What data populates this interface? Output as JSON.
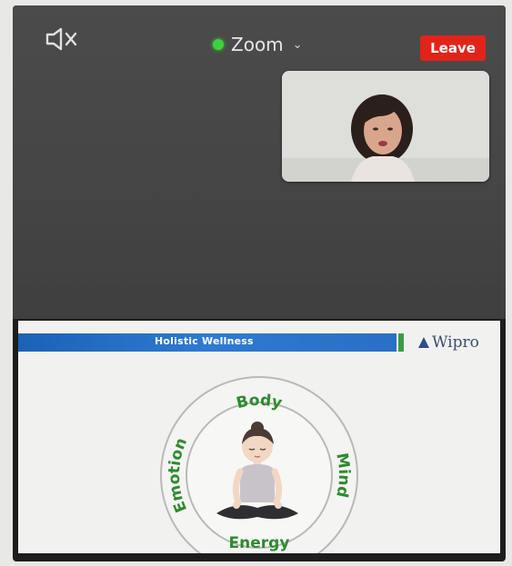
{
  "meeting": {
    "app_menu_label": "Zoom",
    "leave_label": "Leave",
    "status_color": "#3bd23b",
    "leave_color": "#e2231a",
    "audio_icon": "speaker-muted-icon",
    "menu_icon": "chevron-down-icon"
  },
  "self_view": {
    "participant_icon": "participant-video-thumbnail"
  },
  "slide": {
    "header_title": "Holistic Wellness",
    "logo_text": "Wipro",
    "wheel": {
      "top_label": "Body",
      "right_label": "Mind",
      "bottom_label": "Energy",
      "left_label": "Emotion",
      "center_icon": "meditating-person-icon"
    },
    "colors": {
      "header_blue": "#2a6fc4",
      "label_green": "#2f8a2f"
    }
  }
}
